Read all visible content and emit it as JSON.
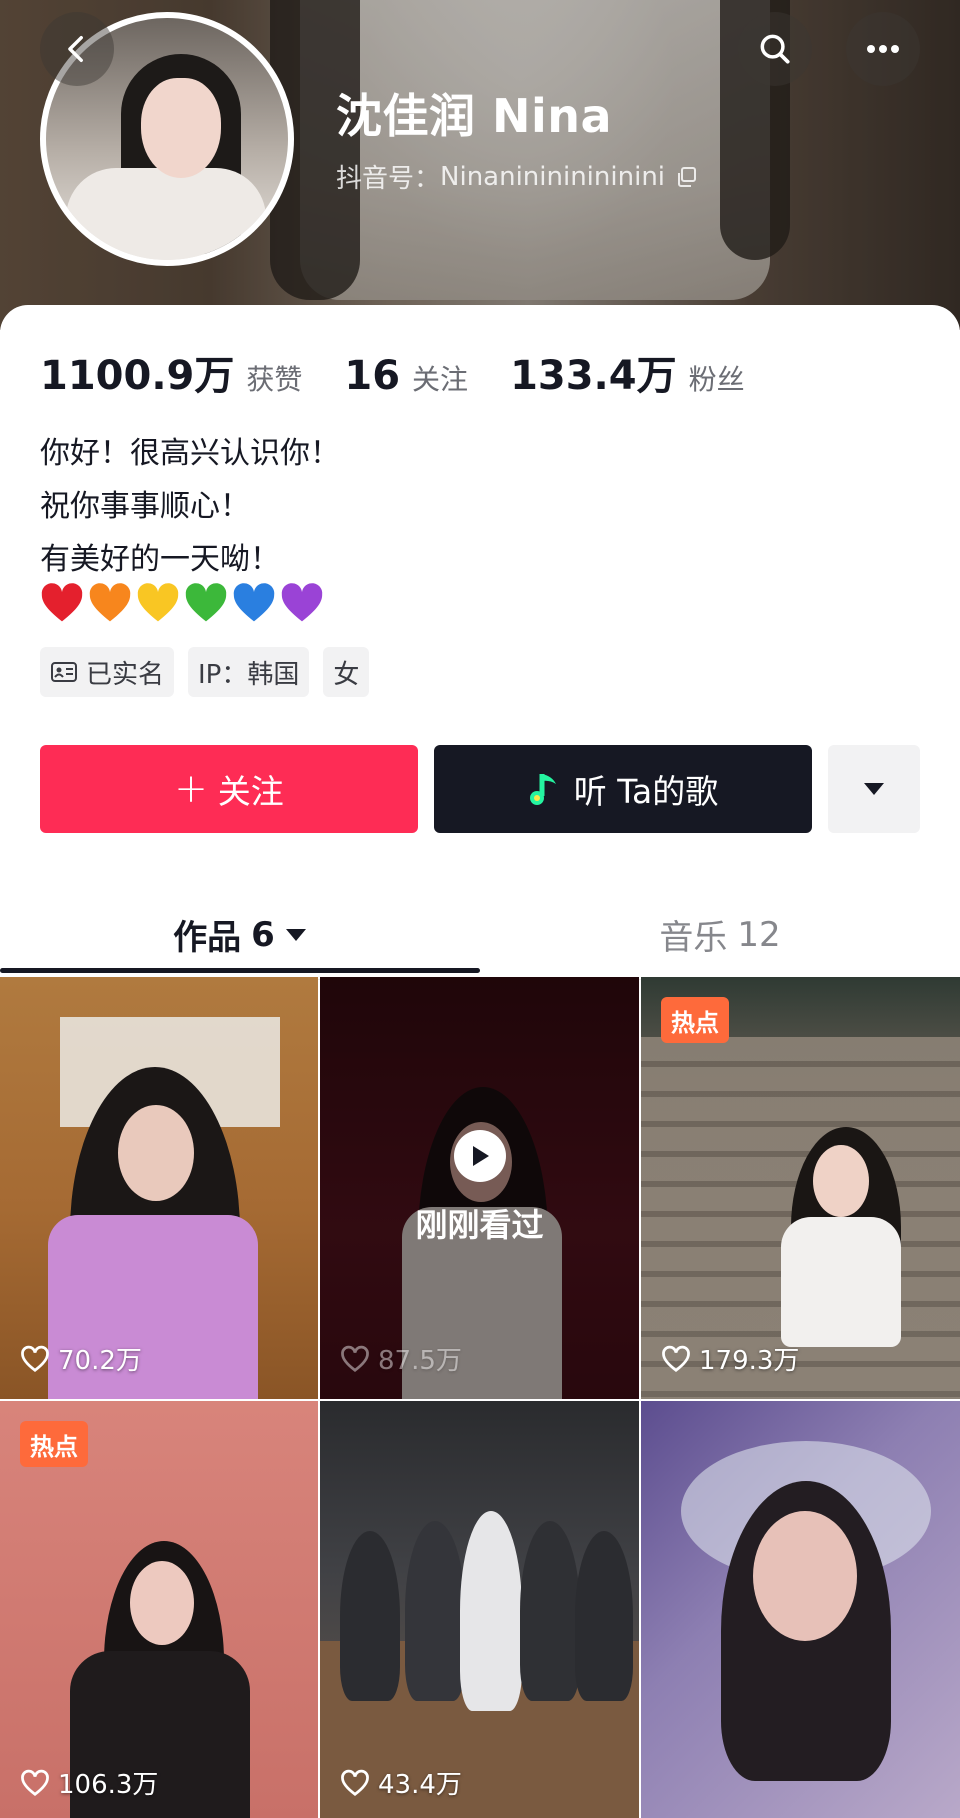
{
  "header": {
    "name": "沈佳润 Nina",
    "douyin_id_label": "抖音号：",
    "douyin_id": "Ninaninininininini"
  },
  "stats": [
    {
      "num": "1100.9万",
      "label": "获赞"
    },
    {
      "num": "16",
      "label": "关注"
    },
    {
      "num": "133.4万",
      "label": "粉丝"
    }
  ],
  "bio": {
    "line1": "你好！很高兴认识你！",
    "line2": "祝你事事顺心！",
    "line3": "有美好的一天呦！",
    "hearts": [
      "#e4202d",
      "#f7861d",
      "#f9c623",
      "#3cb83a",
      "#2a7fe0",
      "#9a43d6"
    ]
  },
  "tags": {
    "verified": "已实名",
    "ip": "IP：韩国",
    "gender": "女"
  },
  "actions": {
    "follow_plus": "+",
    "follow": "关注",
    "song": "听 Ta的歌"
  },
  "tabs": {
    "works_label": "作品",
    "works_count": "6",
    "music_label": "音乐",
    "music_count": "12"
  },
  "videos": [
    {
      "likes": "70.2万",
      "hot": ""
    },
    {
      "likes": "87.5万",
      "watched": "刚刚看过"
    },
    {
      "likes": "179.3万",
      "hot": "热点"
    },
    {
      "likes": "106.3万",
      "hot": "热点"
    },
    {
      "likes": "43.4万",
      "hot": ""
    },
    {
      "likes": "",
      "hot": ""
    }
  ],
  "colors": {
    "follow_button": "#fe2c55",
    "song_button": "#161823",
    "hot_badge": "#fe6a3b",
    "music_icon": "#25f4a0"
  },
  "icons": [
    "back-icon",
    "search-icon",
    "more-icon",
    "copy-icon",
    "id-card-icon",
    "music-note-icon",
    "caret-down-icon",
    "heart-icon",
    "play-icon"
  ]
}
